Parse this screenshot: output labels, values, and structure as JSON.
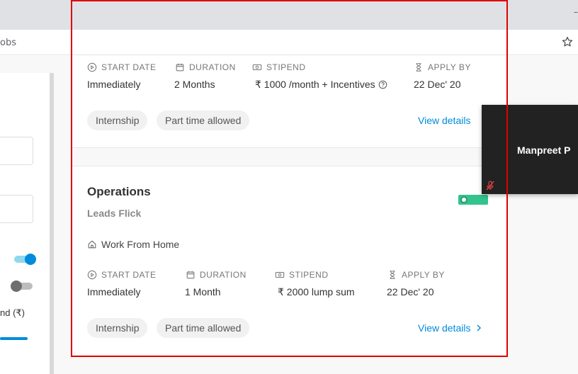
{
  "browser": {
    "window_minimize": "–",
    "address_fragment": "obs",
    "star_icon": "star-outline-icon"
  },
  "filters": {
    "stipend_label": "nd (₹)",
    "toggles": [
      {
        "state": "on"
      },
      {
        "state": "off"
      }
    ]
  },
  "meta_labels": {
    "start_date": "START DATE",
    "duration": "DURATION",
    "stipend": "STIPEND",
    "apply_by": "APPLY BY"
  },
  "jobs": [
    {
      "start_date": "Immediately",
      "duration": "2 Months",
      "stipend": "₹ 1000 /month + Incentives",
      "apply_by": "22 Dec' 20",
      "tags": [
        "Internship",
        "Part time allowed"
      ],
      "view_details": "View details"
    },
    {
      "title": "Operations",
      "company": "Leads Flick",
      "location": "Work From Home",
      "start_date": "Immediately",
      "duration": "1 Month",
      "stipend": "₹ 2000 lump sum",
      "apply_by": "22 Dec' 20",
      "tags": [
        "Internship",
        "Part time allowed"
      ],
      "view_details": "View details"
    }
  ],
  "video_call": {
    "participant_name": "Manpreet  P",
    "mic_icon": "mic-muted-icon"
  },
  "colors": {
    "accent": "#008bdc",
    "highlight": "#e00000"
  }
}
